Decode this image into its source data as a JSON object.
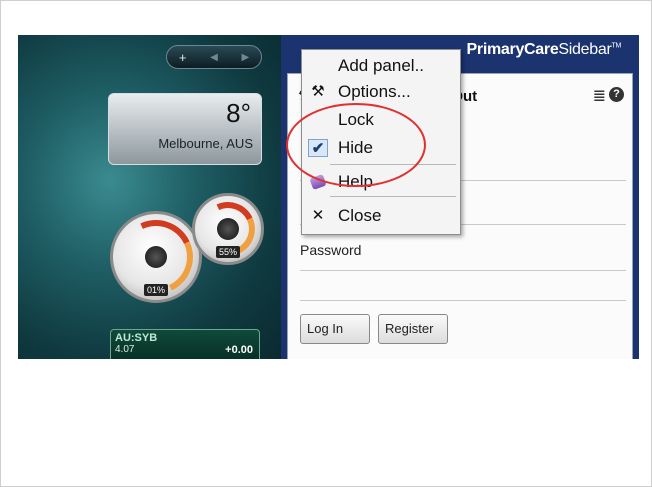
{
  "windows_sidebar": {
    "controls": {
      "add": "+",
      "prev": "◀",
      "next": "▶"
    },
    "weather": {
      "temperature": "8°",
      "location": "Melbourne, AUS"
    },
    "gauges": {
      "cpu_label": "01%",
      "memory_label": "55%"
    },
    "stock": {
      "symbol": "AU:SYB",
      "price": "4.07",
      "change": "+0.00"
    }
  },
  "primarycare": {
    "brand_primary": "PrimaryCare",
    "brand_secondary": "Sidebar",
    "trademark": "TM",
    "heading_partial": "d Out",
    "password_label": "Password",
    "login_button": "Log In",
    "register_button": "Register"
  },
  "context_menu": {
    "items": [
      {
        "label": "Add panel..",
        "icon": ""
      },
      {
        "label": "Options...",
        "icon": "tools-icon"
      },
      {
        "label": "Lock",
        "icon": ""
      },
      {
        "label": "Hide",
        "icon": "check-icon",
        "checked": true
      },
      {
        "label": "Help",
        "icon": "help-icon"
      },
      {
        "label": "Close",
        "icon": "close-icon"
      }
    ]
  },
  "colors": {
    "sidebar_blue": "#1b3470",
    "highlight_circle": "#e03030"
  }
}
